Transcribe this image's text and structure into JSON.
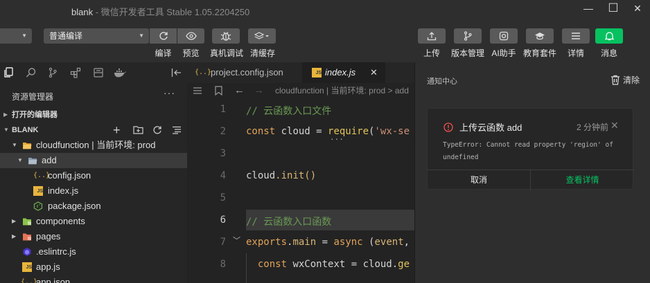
{
  "window": {
    "title": "blank",
    "subtitle": " - 微信开发者工具 Stable 1.05.2204250",
    "minimize": "—",
    "maximize": "☐",
    "close": "✕"
  },
  "toolbar": {
    "compile_mode": "普通编译",
    "labels": {
      "compile": "编译",
      "preview": "预览",
      "real_debug": "真机调试",
      "clear_cache": "清缓存",
      "upload": "上传",
      "version": "版本管理",
      "ai": "AI助手",
      "education": "教育套件",
      "details": "详情",
      "messages": "消息"
    },
    "accent": "#07c160"
  },
  "explorer": {
    "title": "资源管理器",
    "more": "···",
    "open_editors": "打开的编辑器",
    "project": "BLANK",
    "tree": [
      {
        "label": "cloudfunction | 当前环境: prod",
        "type": "folder-open",
        "arrow": "▼"
      },
      {
        "label": "add",
        "type": "folder-open-blue",
        "arrow": "▼"
      },
      {
        "label": "config.json",
        "type": "json"
      },
      {
        "label": "index.js",
        "type": "js"
      },
      {
        "label": "package.json",
        "type": "node"
      },
      {
        "label": "components",
        "type": "folder-green",
        "arrow": "▶"
      },
      {
        "label": "pages",
        "type": "folder-red",
        "arrow": "▶"
      },
      {
        "label": ".eslintrc.js",
        "type": "eslint"
      },
      {
        "label": "app.js",
        "type": "js"
      },
      {
        "label": "app.json",
        "type": "json"
      }
    ]
  },
  "editor": {
    "tabs": [
      {
        "label": "project.config.json",
        "icon": "{..}"
      },
      {
        "label": "index.js",
        "icon": "JS"
      }
    ],
    "tab_close": "✕",
    "breadcrumb": "cloudfunction | 当前环境: prod  >  add",
    "line_numbers": [
      "1",
      "2",
      "3",
      "4",
      "5",
      "6",
      "7",
      "8"
    ],
    "lines": {
      "l1": "// 云函数入口文件",
      "l2a": "const",
      "l2b": " cloud = ",
      "l2c": "require",
      "l2d": "(",
      "l2e": "'wx-se",
      "l4a": "cloud",
      "l4b": ".init()",
      "l6": "// 云函数入口函数",
      "l7a": "exports",
      "l7b": ".",
      "l7c": "main",
      "l7d": " = ",
      "l7e": "async",
      "l7f": " (",
      "l7g": "event",
      "l7h": ",",
      "l8a": "  const",
      "l8b": " wxContext = cloud.",
      "l8c": "ge"
    }
  },
  "notifications": {
    "title": "通知中心",
    "clear": "清除",
    "card": {
      "title": "上传云函数 add",
      "time": "2 分钟前",
      "message": "TypeError: Cannot read property 'region' of undefined",
      "cancel": "取消",
      "view_details": "查看详情"
    }
  }
}
